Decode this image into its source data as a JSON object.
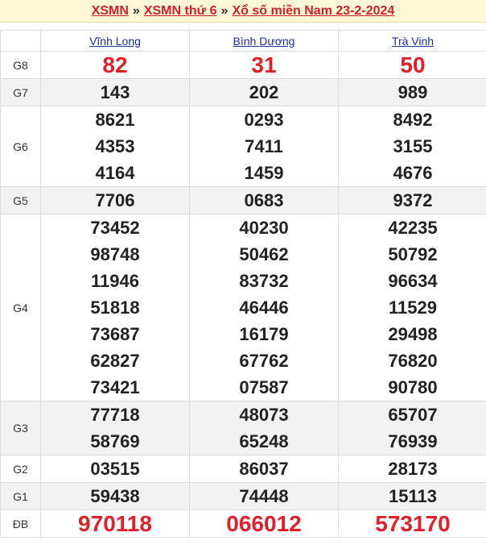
{
  "header": {
    "crumb1": "XSMN",
    "crumb2": "XSMN thứ 6",
    "crumb3": "Xổ số miền Nam 23-2-2024",
    "separator": "»"
  },
  "provinces": [
    "Vĩnh Long",
    "Bình Dương",
    "Trà Vinh"
  ],
  "prizes": [
    {
      "label": "G8",
      "values": [
        [
          "82"
        ],
        [
          "31"
        ],
        [
          "50"
        ]
      ]
    },
    {
      "label": "G7",
      "values": [
        [
          "143"
        ],
        [
          "202"
        ],
        [
          "989"
        ]
      ]
    },
    {
      "label": "G6",
      "values": [
        [
          "8621",
          "4353",
          "4164"
        ],
        [
          "0293",
          "7411",
          "1459"
        ],
        [
          "8492",
          "3155",
          "4676"
        ]
      ]
    },
    {
      "label": "G5",
      "values": [
        [
          "7706"
        ],
        [
          "0683"
        ],
        [
          "9372"
        ]
      ]
    },
    {
      "label": "G4",
      "values": [
        [
          "73452",
          "98748",
          "11946",
          "51818",
          "73687",
          "62827",
          "73421"
        ],
        [
          "40230",
          "50462",
          "83732",
          "46446",
          "16179",
          "67762",
          "07587"
        ],
        [
          "42235",
          "50792",
          "96634",
          "11529",
          "29498",
          "76820",
          "90780"
        ]
      ]
    },
    {
      "label": "G3",
      "values": [
        [
          "77718",
          "58769"
        ],
        [
          "48073",
          "65248"
        ],
        [
          "65707",
          "76939"
        ]
      ]
    },
    {
      "label": "G2",
      "values": [
        [
          "03515"
        ],
        [
          "86037"
        ],
        [
          "28173"
        ]
      ]
    },
    {
      "label": "G1",
      "values": [
        [
          "59438"
        ],
        [
          "74448"
        ],
        [
          "15113"
        ]
      ]
    },
    {
      "label": "ĐB",
      "values": [
        [
          "970118"
        ],
        [
          "066012"
        ],
        [
          "573170"
        ]
      ]
    }
  ],
  "colors": {
    "accent_red": "#e0202a",
    "link_blue": "#1a2ea8",
    "header_bg": "#fff8d6",
    "alt_row": "#f2f2f2"
  }
}
